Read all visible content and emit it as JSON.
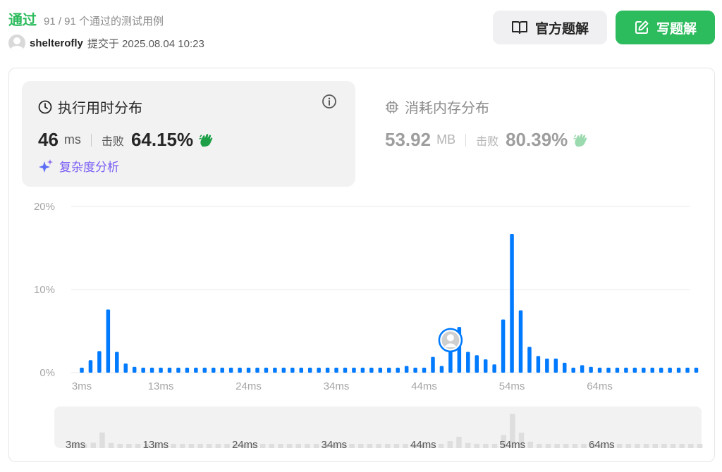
{
  "header": {
    "status": "通过",
    "cases": "91 / 91 个通过的测试用例",
    "username": "shelterofly",
    "submitted": "提交于 2025.08.04 10:23"
  },
  "buttons": {
    "official": "官方题解",
    "write": "写题解"
  },
  "runtime_tab": {
    "title": "执行用时分布",
    "value": "46",
    "unit": "ms",
    "beats_label": "击败",
    "beats": "64.15%",
    "complexity": "复杂度分析"
  },
  "memory_tab": {
    "title": "消耗内存分布",
    "value": "53.92",
    "unit": "MB",
    "beats_label": "击败",
    "beats": "80.39%"
  },
  "colors": {
    "accent_green": "#2cbb5d",
    "bar_blue": "#007aff",
    "purple": "#7a5cf5"
  },
  "icons": {
    "runtime": "clock-icon",
    "memory": "chip-icon",
    "info": "info-icon",
    "official": "book-icon",
    "write": "edit-icon",
    "beats": "clapping-hands-icon",
    "complexity": "sparkle-icon"
  },
  "chart_data": {
    "type": "bar",
    "y_ticks": [
      "0%",
      "10%",
      "20%"
    ],
    "ylim": [
      0,
      20
    ],
    "x_tick_labels": [
      "3ms",
      "13ms",
      "24ms",
      "34ms",
      "44ms",
      "54ms",
      "64ms"
    ],
    "x_tick_index": [
      0,
      9,
      19,
      29,
      39,
      49,
      59
    ],
    "current_index": 42,
    "grid": true,
    "values": [
      0.6,
      1.5,
      2.6,
      7.6,
      2.5,
      1.1,
      0.7,
      0.6,
      0.6,
      0.6,
      0.6,
      0.6,
      0.6,
      0.6,
      0.6,
      0.6,
      0.6,
      0.6,
      0.6,
      0.6,
      0.6,
      0.6,
      0.6,
      0.6,
      0.6,
      0.6,
      0.6,
      0.6,
      0.6,
      0.6,
      0.6,
      0.6,
      0.6,
      0.6,
      0.6,
      0.6,
      0.6,
      0.8,
      0.6,
      0.6,
      1.9,
      0.8,
      3.4,
      5.5,
      2.5,
      2.1,
      1.6,
      1.0,
      6.4,
      16.7,
      7.5,
      3.1,
      2.0,
      1.7,
      1.7,
      1.2,
      0.6,
      0.9,
      0.7,
      0.6,
      0.6,
      0.6,
      0.6,
      0.6,
      0.6,
      0.6,
      0.6,
      0.6,
      0.6,
      0.6,
      0.6
    ]
  }
}
